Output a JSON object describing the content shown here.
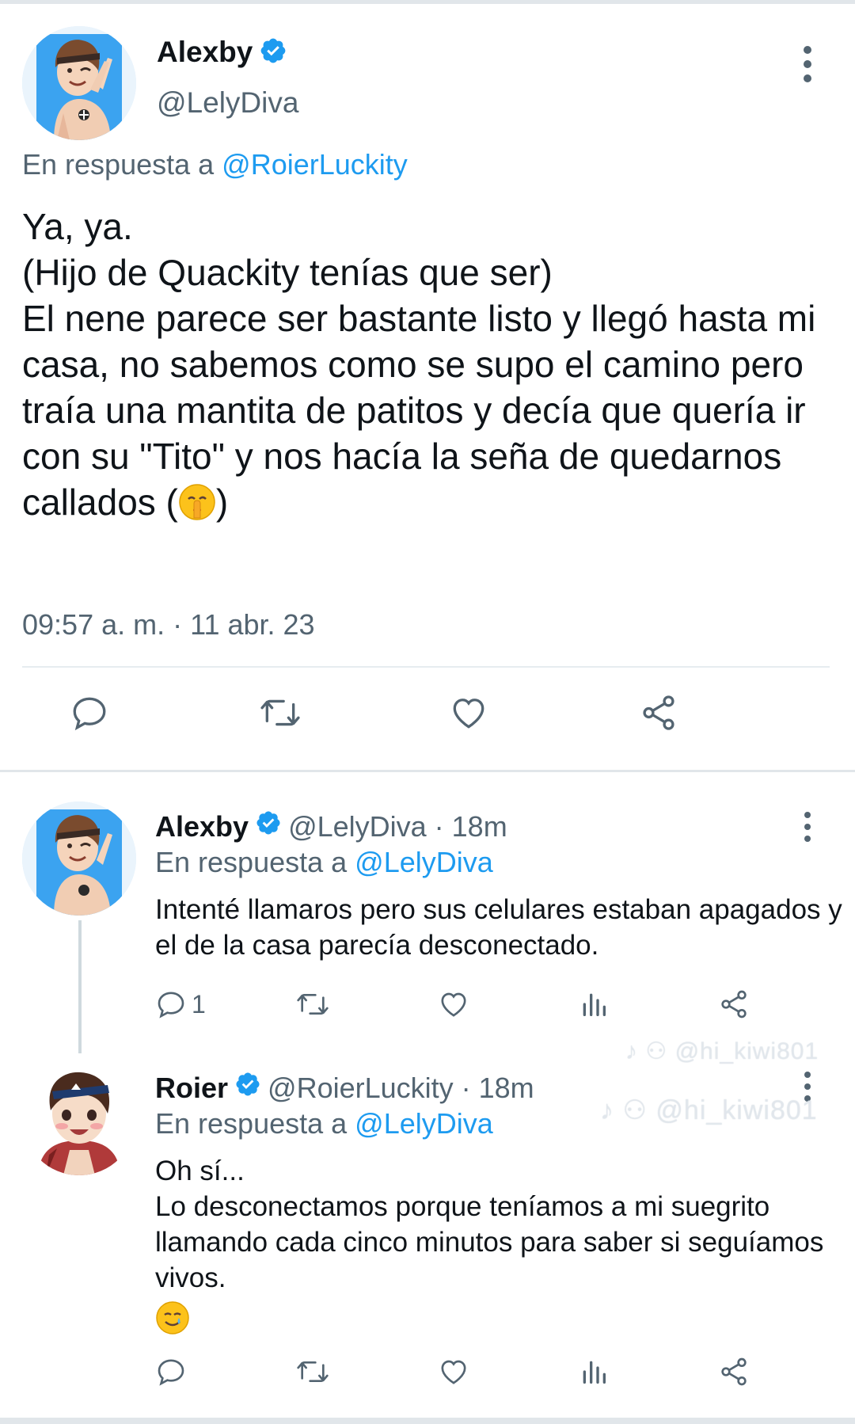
{
  "colors": {
    "accent": "#1d9bf0",
    "text_primary": "#0f1419",
    "text_secondary": "#536471",
    "divider": "#e6ecf0"
  },
  "main_tweet": {
    "author_name": "Alexby",
    "verified": true,
    "handle": "@LelyDiva",
    "reply_prefix": "En respuesta a",
    "reply_mention": "@RoierLuckity",
    "text": "Ya, ya.\n(Hijo de Quackity tenías que ser)\nEl nene parece ser bastante listo y llegó hasta mi casa, no sabemos como se supo el camino pero traía una mantita de patitos y decía que quería ir con su \"Tito\" y nos hacía la seña de quedarnos callados (",
    "text_end": ")",
    "text_emoji": "shushing-face",
    "timestamp": "09:57 a. m. · 11 abr. 23",
    "actions": [
      "reply-icon",
      "retweet-icon",
      "like-icon",
      "share-icon"
    ]
  },
  "replies": [
    {
      "author_name": "Alexby",
      "verified": true,
      "handle_time": "@LelyDiva · 18m",
      "reply_prefix": "En respuesta a",
      "reply_mention": "@LelyDiva",
      "text": "Intenté llamaros pero sus celulares estaban apagados y el de la casa parecía desconectado.",
      "reply_count": "1",
      "actions": [
        "reply-icon",
        "retweet-icon",
        "like-icon",
        "views-icon",
        "share-icon"
      ]
    },
    {
      "author_name": "Roier",
      "verified": true,
      "handle_time": "@RoierLuckity · 18m",
      "reply_prefix": "En respuesta a",
      "reply_mention": "@LelyDiva",
      "text": "Oh sí...\nLo desconectamos porque teníamos a mi suegrito llamando cada cinco minutos para saber si seguíamos vivos.",
      "text_emoji": "smiling-face-with-tear",
      "actions": [
        "reply-icon",
        "retweet-icon",
        "like-icon",
        "views-icon",
        "share-icon"
      ]
    }
  ],
  "watermark": {
    "text_1": "@hi_kiwi801",
    "text_2": "@hi_kiwi801"
  }
}
